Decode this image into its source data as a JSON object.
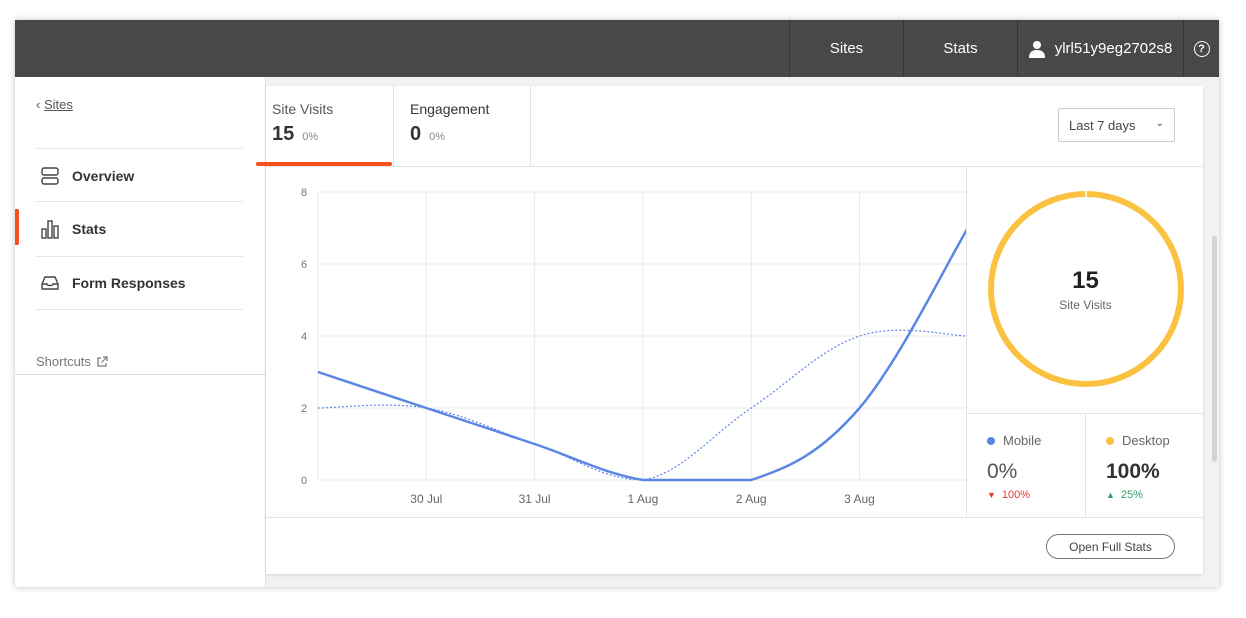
{
  "topbar": {
    "nav": [
      {
        "label": "Sites"
      },
      {
        "label": "Stats"
      }
    ],
    "username": "ylrl51y9eg2702s8",
    "help_glyph": "?"
  },
  "sidebar": {
    "back_label": "Sites",
    "items": [
      {
        "label": "Overview",
        "icon": "overview-icon"
      },
      {
        "label": "Stats",
        "icon": "bar-chart-icon",
        "active": true
      },
      {
        "label": "Form Responses",
        "icon": "inbox-icon"
      }
    ],
    "shortcuts_label": "Shortcuts"
  },
  "tabs": [
    {
      "label": "Site Visits",
      "value": "15",
      "change": "0%"
    },
    {
      "label": "Engagement",
      "value": "0",
      "change": "0%"
    }
  ],
  "range_select": {
    "selected": "Last 7 days"
  },
  "chart_data": {
    "type": "line",
    "categories": [
      "30 Jul",
      "31 Jul",
      "1 Aug",
      "2 Aug",
      "3 Aug"
    ],
    "x": [
      0,
      1,
      2,
      3,
      4,
      5,
      6
    ],
    "series": [
      {
        "values": [
          3,
          2,
          1,
          0,
          0,
          2,
          7
        ],
        "style": "solid",
        "color": "#5b86e5"
      },
      {
        "values": [
          2,
          2,
          1,
          0,
          2,
          4,
          4
        ],
        "style": "dotted",
        "color": "#5b86e5"
      }
    ],
    "ylim": [
      0,
      8
    ],
    "yticks": [
      0,
      2,
      4,
      6,
      8
    ],
    "grid": true
  },
  "summary": {
    "total": "15",
    "total_label": "Site Visits",
    "donut_color": "#fbc140"
  },
  "devices": [
    {
      "name": "Mobile",
      "pct": "0%",
      "change": "100%",
      "direction": "down",
      "color": "#5b86e5"
    },
    {
      "name": "Desktop",
      "pct": "100%",
      "change": "25%",
      "direction": "up",
      "color": "#fbc140"
    }
  ],
  "footer": {
    "button_label": "Open Full Stats"
  }
}
